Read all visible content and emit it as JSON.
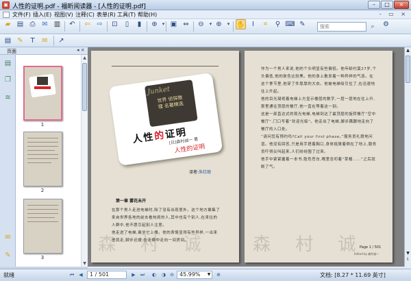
{
  "window": {
    "title": "人性的证明.pdf - 福昕阅读器 - [人性的证明.pdf]",
    "app_icon": "pdf-app-icon"
  },
  "menu": [
    "文件(F)",
    "插入(E)",
    "视图(V)",
    "注释(C)",
    "表单(R)",
    "工具(T)",
    "帮助(H)"
  ],
  "mdi_controls": "- ▭ ×",
  "toolbar": {
    "search_placeholder": "搜索"
  },
  "panel": {
    "title": "页面",
    "collapse": "◂ ×",
    "thumb_labels": [
      "1",
      "2",
      "3"
    ]
  },
  "page_left": {
    "series": "世界 侦探推理 名著精选",
    "script": "Junket",
    "title_black1": "人性",
    "title_red": "的",
    "title_black2": "证明",
    "author": "[日]森村诚一 著",
    "subtitle": "人性的证明",
    "translator_label": "译者:",
    "translator_name": "朱红丽",
    "chapter": "第一章  雾花未开",
    "para1": "在那个男人走进电梯时,除了没有出现意外。这个地方聚集了来自世界各地的前去看热闹的人,其中也有个别人,在来往的人群中,他不愿引起别人注意。",
    "para2": "他走进了电梯,乘坐它上楼。他的表情显得有些异样,一出来他就走,脚步迟缓,在走廊中走向一间房间。",
    "watermark": "森 村 诚 一"
  },
  "page_right": {
    "para": "作为一个男人来说,他的个头明显有些偏低。他年龄约莫27岁,个头偏低,他的肤色比较黑。他的身上散发着一种异样的气息。在这个季节里,他穿了件厚厚的大衣。他被电梯吸引住了,在迅速地往上升起。\n他的目光凝视着电梯上方显示楼层的数字,一层一层地在往上升,那里通往顶层的餐厅,他一直在等着这一刻。\n这是一部直达式的观光电梯,电梯到达了最顶层的旋转餐厅“空中餐厅”,门口写着“欢迎光临”。他走出了电梯,脚步蹒跚地走向了餐厅的入口处。\n“请问您有预约吗?Call your first phase。”服务员礼貌地问道。他没有回答,只是用手捂着胸口,身体摇晃着倒在了地上,服务员吓得尖叫起来,人们纷纷围了过来。\n他手中紧紧握着一本书,脸色苍白,嘴里念叨着“草帽……”之后就断了气。",
    "watermark": "森 村 诚 一",
    "footer": "Page 1 / 501",
    "footer_small": "Edited by 森村诚一"
  },
  "status": {
    "ready": "就绪",
    "page_input": "1 / 501",
    "zoom": "45.99%",
    "doc_size": "文档: [8.27 * 11.69 英寸]"
  }
}
